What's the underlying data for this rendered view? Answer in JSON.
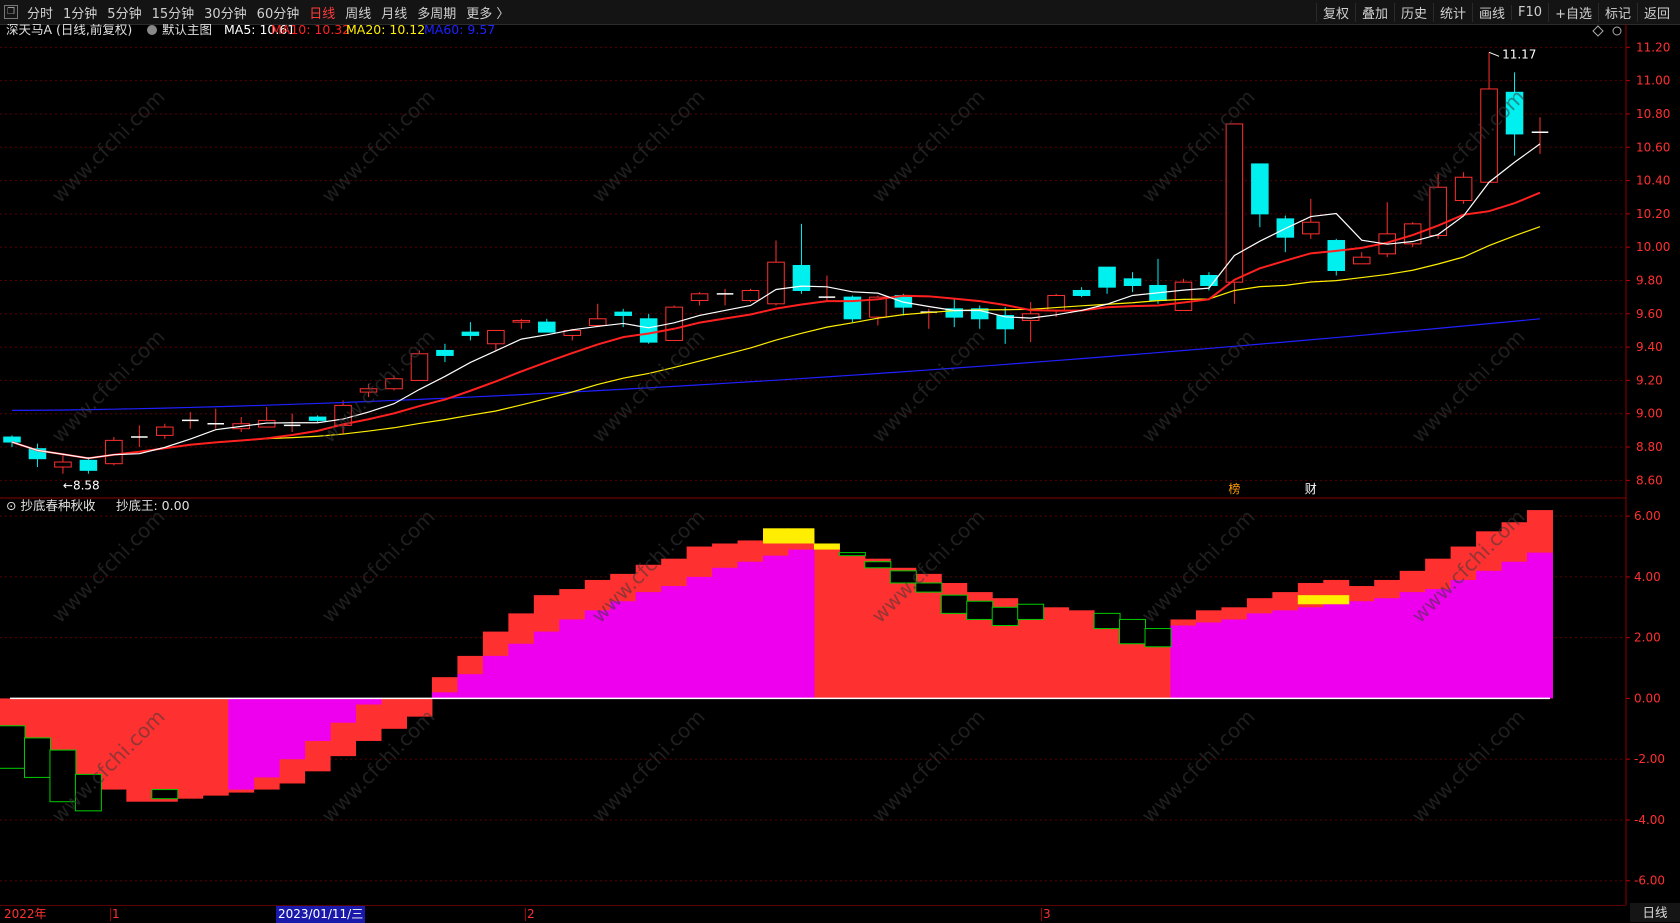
{
  "toolbar": {
    "periods": [
      "分时",
      "1分钟",
      "5分钟",
      "15分钟",
      "30分钟",
      "60分钟",
      "日线",
      "周线",
      "月线",
      "多周期",
      "更多 〉"
    ],
    "active_period": "日线",
    "buttons": [
      "复权",
      "叠加",
      "历史",
      "统计",
      "画线",
      "F10",
      "+自选",
      "标记",
      "返回"
    ]
  },
  "main_chart": {
    "stock_name": "深天马A (日线,前复权)",
    "indicator_name": "默认主图",
    "ma5": {
      "label": "MA5:",
      "value": "10.61",
      "color": "#ffffff"
    },
    "ma10": {
      "label": "MA10:",
      "value": "10.32",
      "color": "#ff2020"
    },
    "ma20": {
      "label": "MA20:",
      "value": "10.12",
      "color": "#ffee00"
    },
    "ma60": {
      "label": "MA60:",
      "value": "9.57",
      "color": "#2020ff"
    },
    "high_label": "11.17",
    "low_label": "8.58",
    "marks": [
      "榜",
      "财"
    ],
    "y_ticks": [
      "11.20",
      "11.00",
      "10.80",
      "10.60",
      "10.40",
      "10.20",
      "10.00",
      "9.80",
      "9.60",
      "9.40",
      "9.20",
      "9.00",
      "8.80",
      "8.60"
    ]
  },
  "sub_chart": {
    "indicator_name": "抄底春种秋收",
    "value_label": "抄底王:",
    "value": "0.00",
    "y_ticks": [
      "6.00",
      "4.00",
      "2.00",
      "0.00",
      "-2.00",
      "-4.00",
      "-6.00"
    ]
  },
  "date_axis": {
    "year": "2022年",
    "months": [
      "1",
      "2",
      "3"
    ],
    "cursor_date": "2023/01/11/三"
  },
  "period_label": "日线",
  "watermark": "www.cfchi.com",
  "colors": {
    "up": "#ff3030",
    "down": "#00f0f0",
    "magenta": "#ee00ee",
    "yellow": "#ffee00",
    "green": "#00cc00",
    "grid": "#5a0000"
  },
  "chart_data": {
    "type": "candlestick",
    "ylim": [
      8.5,
      11.25
    ],
    "candles": [
      [
        8.86,
        8.83,
        8.87,
        8.8
      ],
      [
        8.79,
        8.73,
        8.82,
        8.68
      ],
      [
        8.68,
        8.71,
        8.75,
        8.64
      ],
      [
        8.72,
        8.66,
        8.74,
        8.64
      ],
      [
        8.7,
        8.84,
        8.86,
        8.69
      ],
      [
        8.86,
        8.86,
        8.93,
        8.8
      ],
      [
        8.87,
        8.92,
        8.94,
        8.85
      ],
      [
        8.96,
        8.96,
        9.01,
        8.91
      ],
      [
        8.94,
        8.94,
        9.03,
        8.91
      ],
      [
        8.91,
        8.94,
        8.98,
        8.89
      ],
      [
        8.92,
        8.96,
        9.04,
        8.92
      ],
      [
        8.93,
        8.93,
        9.0,
        8.89
      ],
      [
        8.98,
        8.96,
        8.99,
        8.95
      ],
      [
        8.93,
        9.05,
        9.08,
        8.88
      ],
      [
        9.13,
        9.15,
        9.18,
        9.1
      ],
      [
        9.15,
        9.21,
        9.23,
        9.14
      ],
      [
        9.2,
        9.36,
        9.38,
        9.2
      ],
      [
        9.38,
        9.35,
        9.42,
        9.31
      ],
      [
        9.49,
        9.47,
        9.55,
        9.44
      ],
      [
        9.42,
        9.5,
        9.5,
        9.38
      ],
      [
        9.55,
        9.56,
        9.57,
        9.51
      ],
      [
        9.55,
        9.49,
        9.57,
        9.49
      ],
      [
        9.47,
        9.5,
        9.51,
        9.44
      ],
      [
        9.53,
        9.57,
        9.66,
        9.52
      ],
      [
        9.61,
        9.59,
        9.63,
        9.52
      ],
      [
        9.57,
        9.43,
        9.6,
        9.42
      ],
      [
        9.44,
        9.64,
        9.65,
        9.44
      ],
      [
        9.68,
        9.72,
        9.73,
        9.65
      ],
      [
        9.72,
        9.72,
        9.75,
        9.65
      ],
      [
        9.68,
        9.74,
        9.75,
        9.67
      ],
      [
        9.66,
        9.91,
        10.04,
        9.65
      ],
      [
        9.89,
        9.74,
        10.14,
        9.72
      ],
      [
        9.7,
        9.7,
        9.83,
        9.68
      ],
      [
        9.7,
        9.57,
        9.71,
        9.55
      ],
      [
        9.58,
        9.7,
        9.71,
        9.53
      ],
      [
        9.71,
        9.64,
        9.72,
        9.59
      ],
      [
        9.61,
        9.61,
        9.63,
        9.51
      ],
      [
        9.63,
        9.58,
        9.69,
        9.52
      ],
      [
        9.63,
        9.57,
        9.65,
        9.51
      ],
      [
        9.59,
        9.51,
        9.64,
        9.42
      ],
      [
        9.56,
        9.6,
        9.67,
        9.43
      ],
      [
        9.62,
        9.71,
        9.72,
        9.58
      ],
      [
        9.74,
        9.71,
        9.76,
        9.7
      ],
      [
        9.88,
        9.76,
        9.88,
        9.72
      ],
      [
        9.81,
        9.77,
        9.85,
        9.73
      ],
      [
        9.77,
        9.68,
        9.93,
        9.66
      ],
      [
        9.62,
        9.79,
        9.81,
        9.62
      ],
      [
        9.83,
        9.77,
        9.85,
        9.74
      ],
      [
        9.79,
        10.74,
        10.74,
        9.66
      ],
      [
        10.5,
        10.2,
        10.5,
        10.12
      ],
      [
        10.17,
        10.06,
        10.19,
        9.97
      ],
      [
        10.08,
        10.15,
        10.29,
        10.05
      ],
      [
        10.04,
        9.86,
        10.05,
        9.83
      ],
      [
        9.9,
        9.94,
        9.97,
        9.92
      ],
      [
        9.96,
        10.08,
        10.27,
        9.94
      ],
      [
        10.02,
        10.14,
        10.15,
        10.0
      ],
      [
        10.07,
        10.36,
        10.44,
        10.05
      ],
      [
        10.28,
        10.42,
        10.45,
        10.26
      ],
      [
        10.39,
        10.95,
        11.17,
        10.39
      ],
      [
        10.93,
        10.68,
        11.05,
        10.55
      ],
      [
        10.69,
        10.69,
        10.78,
        10.56
      ]
    ],
    "ma5_last": 10.61,
    "ma10_last": 10.32,
    "ma20_last": 10.12,
    "ma60_last": 9.57,
    "sub": {
      "type": "bar",
      "ylim": [
        -6.8,
        6.4
      ],
      "red_total": [
        -1.6,
        -1.9,
        -2.2,
        -2.6,
        -3.0,
        -3.4,
        -3.4,
        -3.3,
        -3.2,
        -3.1,
        -3.0,
        -2.8,
        -2.4,
        -1.9,
        -1.4,
        -1.0,
        -0.6,
        0.7,
        1.4,
        2.2,
        2.8,
        3.4,
        3.6,
        3.9,
        4.1,
        4.4,
        4.6,
        5.0,
        5.1,
        5.2,
        5.5,
        5.4,
        5.0,
        4.8,
        4.6,
        4.3,
        4.1,
        3.8,
        3.5,
        3.3,
        3.1,
        3.0,
        2.9,
        2.6,
        2.4,
        2.0,
        2.6,
        2.9,
        3.0,
        3.3,
        3.5,
        3.8,
        3.9,
        3.7,
        3.9,
        4.2,
        4.6,
        5.0,
        5.5,
        5.8,
        6.2
      ],
      "magenta": [
        0,
        0,
        0,
        0,
        0,
        0,
        0,
        0,
        0,
        -3.0,
        -2.6,
        -2.0,
        -1.4,
        -0.8,
        -0.2,
        0,
        0,
        0.2,
        0.8,
        1.4,
        1.8,
        2.2,
        2.6,
        2.9,
        3.2,
        3.5,
        3.7,
        4.0,
        4.3,
        4.5,
        4.7,
        4.9,
        0,
        0,
        0,
        0,
        0,
        0,
        0,
        0,
        0,
        0,
        0,
        0,
        0,
        0,
        2.4,
        2.5,
        2.6,
        2.8,
        2.9,
        3.0,
        3.1,
        3.2,
        3.3,
        3.5,
        3.6,
        3.9,
        4.2,
        4.5,
        4.8
      ],
      "green_boxes": [
        [
          0,
          -0.9,
          -2.3
        ],
        [
          1,
          -1.3,
          -2.6
        ],
        [
          2,
          -1.7,
          -3.4
        ],
        [
          3,
          -2.5,
          -3.7
        ],
        [
          6,
          -3.0,
          -3.3
        ],
        [
          33,
          4.8,
          4.7
        ],
        [
          34,
          4.5,
          4.3
        ],
        [
          35,
          4.2,
          3.8
        ],
        [
          36,
          3.8,
          3.5
        ],
        [
          37,
          3.4,
          2.8
        ],
        [
          38,
          3.2,
          2.6
        ],
        [
          39,
          3.0,
          2.4
        ],
        [
          40,
          3.1,
          2.6
        ],
        [
          43,
          2.8,
          2.3
        ],
        [
          44,
          2.6,
          1.8
        ],
        [
          45,
          2.3,
          1.7
        ]
      ],
      "yellow": [
        [
          30,
          5.6,
          5.1
        ],
        [
          31,
          5.6,
          5.1
        ],
        [
          32,
          5.1,
          4.9
        ],
        [
          51,
          3.4,
          3.1
        ],
        [
          52,
          3.4,
          3.1
        ]
      ]
    }
  }
}
